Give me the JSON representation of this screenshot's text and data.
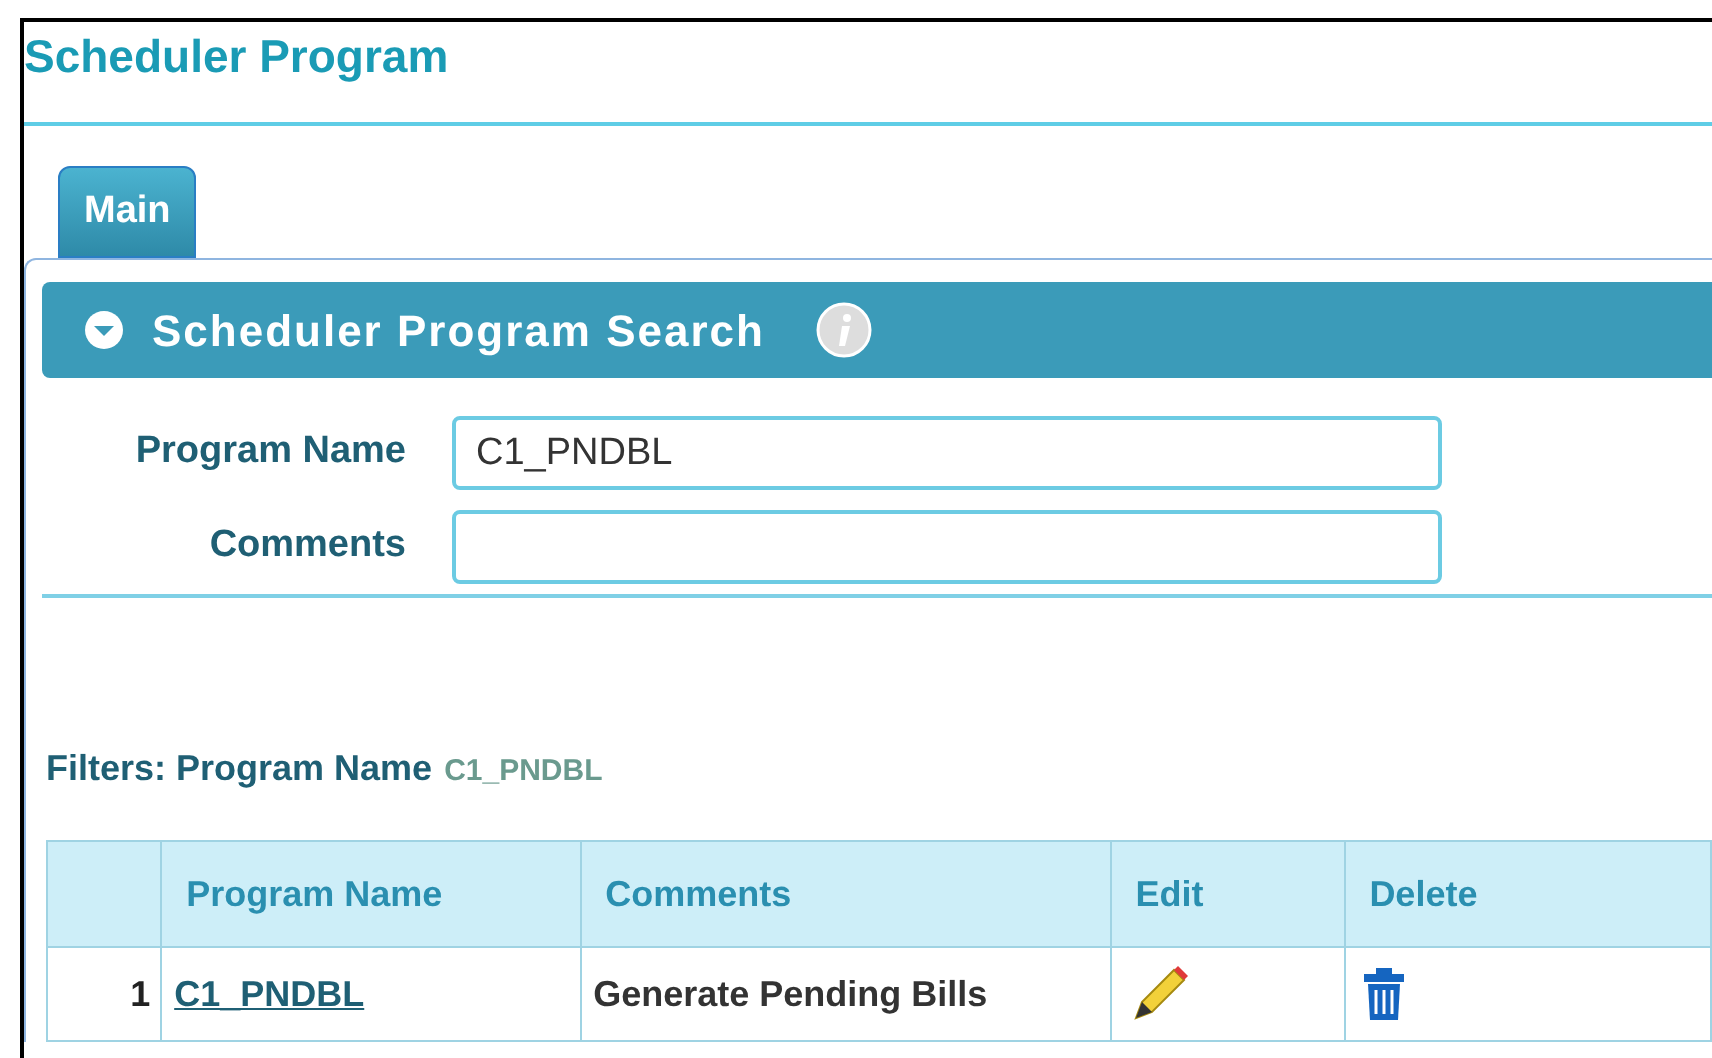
{
  "page_title": "Scheduler Program",
  "tabs": [
    {
      "label": "Main",
      "selected": true
    }
  ],
  "section": {
    "title": "Scheduler Program Search",
    "expanded": true
  },
  "form": [
    {
      "label": "Program Name",
      "value": "C1_PNDBL"
    },
    {
      "label": "Comments"
    }
  ],
  "filters": {
    "label": "Filters: Program Name",
    "value": "C1_PNDBL"
  },
  "table": {
    "columns": [
      "Program Name",
      "Comments",
      "Edit",
      "Delete"
    ],
    "rows": [
      {
        "index": "1",
        "program_name": "C1_PNDBL",
        "comments": "Generate Pending Bills"
      }
    ]
  }
}
